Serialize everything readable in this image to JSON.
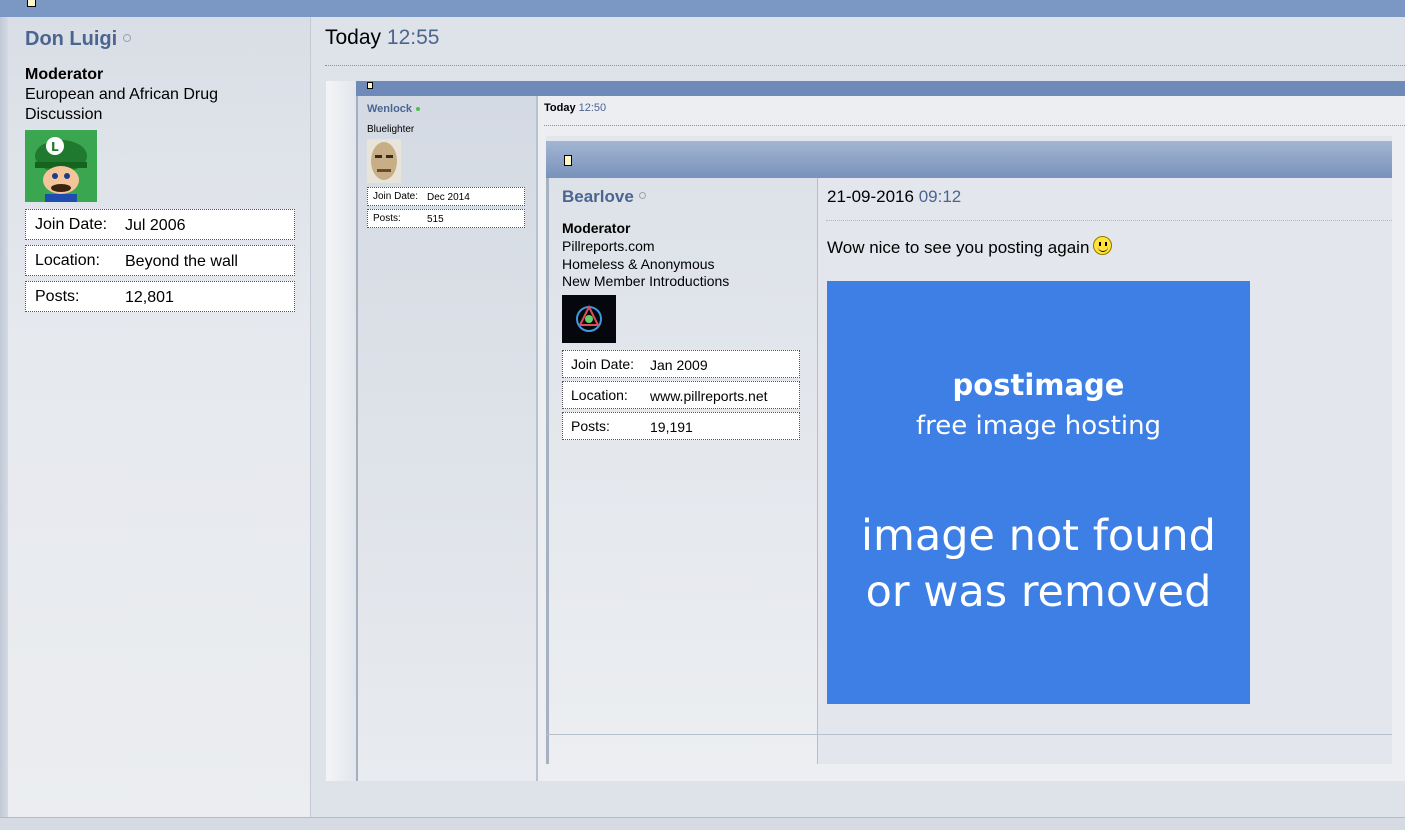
{
  "post": {
    "username": "Don Luigi",
    "role": "Moderator",
    "group_line1": "European and African Drug",
    "group_line2": "Discussion",
    "details": [
      {
        "label": "Join Date:",
        "value": "Jul 2006"
      },
      {
        "label": "Location:",
        "value": "Beyond the wall"
      },
      {
        "label": "Posts:",
        "value": "12,801"
      }
    ],
    "date": "Today",
    "time": "12:55"
  },
  "quoted_post": {
    "username": "Wenlock",
    "title": "Bluelighter",
    "details": [
      {
        "label": "Join Date:",
        "value": "Dec 2014"
      },
      {
        "label": "Posts:",
        "value": "515"
      }
    ],
    "date": "Today",
    "time": "12:50"
  },
  "nested_post": {
    "username": "Bearlove",
    "role": "Moderator",
    "groups": [
      "Pillreports.com",
      "Homeless & Anonymous",
      "New Member Introductions"
    ],
    "details": [
      {
        "label": "Join Date:",
        "value": "Jan 2009"
      },
      {
        "label": "Location:",
        "value": "www.pillreports.net"
      },
      {
        "label": "Posts:",
        "value": "19,191"
      }
    ],
    "date": "21-09-2016",
    "time": "09:12",
    "message": "Wow nice to see you posting again",
    "image": {
      "brand": "postimage",
      "tagline": "free image hosting",
      "error_line1": "image not found",
      "error_line2": "or was removed"
    }
  },
  "colors": {
    "accent": "#4b6591",
    "topbar": "#7b98c4",
    "placeholder": "#3d7fe4"
  }
}
